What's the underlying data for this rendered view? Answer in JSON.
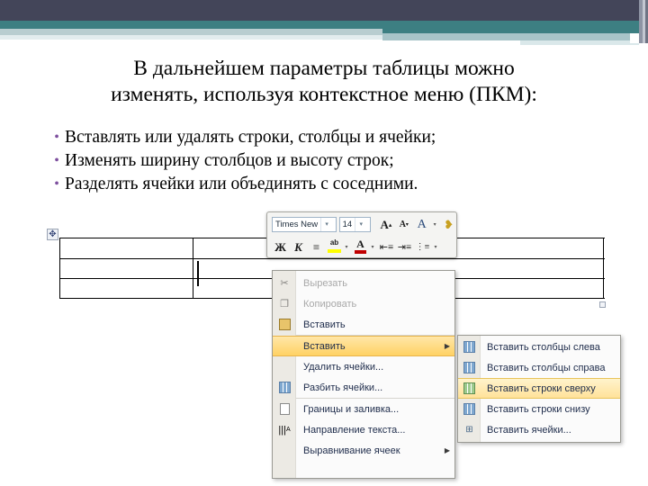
{
  "slide": {
    "title_lines": [
      "В дальнейшем параметры таблицы можно",
      "изменять, используя контекстное меню (ПКМ):"
    ],
    "bullets": [
      "Вставлять или удалять строки, столбцы и ячейки;",
      "Изменять ширину столбцов и высоту строк;",
      "Разделять ячейки или объединять с соседними."
    ],
    "bullet_marker": "•",
    "colors": {
      "header_dark": "#434559",
      "header_teal": "#3d7f82",
      "header_pale": "#b8cdd0",
      "bullet_marker": "#7d4f9e",
      "menu_highlight": "#ffd264",
      "text": "#000000"
    }
  },
  "mini_toolbar": {
    "font_name": "Times New",
    "font_size": "14",
    "dropdown_arrow": "▾",
    "buttons": [
      {
        "name": "grow-font",
        "glyph": "A"
      },
      {
        "name": "shrink-font",
        "glyph": "A"
      },
      {
        "name": "clear-formatting",
        "glyph": "A"
      },
      {
        "name": "format-painter",
        "glyph": "✔"
      },
      {
        "name": "bold",
        "glyph": "Ж"
      },
      {
        "name": "italic",
        "glyph": "K"
      },
      {
        "name": "center",
        "glyph": "≡"
      },
      {
        "name": "highlight",
        "glyph": "ab"
      },
      {
        "name": "font-color",
        "glyph": "A"
      },
      {
        "name": "decrease-indent",
        "glyph": "≼"
      },
      {
        "name": "increase-indent",
        "glyph": "≽"
      },
      {
        "name": "bullets",
        "glyph": "≔"
      }
    ]
  },
  "context_menu": {
    "items": [
      {
        "label": "Вырезать",
        "icon": "scissors-icon",
        "disabled": true,
        "submenu": false,
        "divider_after": false
      },
      {
        "label": "Копировать",
        "icon": "copy-icon",
        "disabled": true,
        "submenu": false,
        "divider_after": false
      },
      {
        "label": "Вставить",
        "icon": "paste-icon",
        "disabled": false,
        "submenu": false,
        "divider_after": true
      },
      {
        "label": "Вставить",
        "icon": "insert-icon",
        "disabled": false,
        "submenu": true,
        "divider_after": false,
        "selected": true
      },
      {
        "label": "Удалить ячейки...",
        "icon": "delete-cells-icon",
        "disabled": false,
        "submenu": false,
        "divider_after": false
      },
      {
        "label": "Разбить ячейки...",
        "icon": "split-cells-icon",
        "disabled": false,
        "submenu": false,
        "divider_after": true
      },
      {
        "label": "Границы и заливка...",
        "icon": "borders-shading-icon",
        "disabled": false,
        "submenu": false,
        "divider_after": false
      },
      {
        "label": "Направление текста...",
        "icon": "text-direction-icon",
        "disabled": false,
        "submenu": false,
        "divider_after": false
      },
      {
        "label": "Выравнивание ячеек",
        "icon": "cell-align-icon",
        "disabled": false,
        "submenu": true,
        "divider_after": false
      }
    ],
    "scissors_glyph": "✂",
    "copy_glyph": "❐",
    "text_direction_glyph": "A",
    "align_glyph": "▤",
    "submenu_arrow": "▶"
  },
  "submenu": {
    "items": [
      {
        "label": "Вставить столбцы слева",
        "icon": "insert-columns-left-icon",
        "selected": false
      },
      {
        "label": "Вставить столбцы справа",
        "icon": "insert-columns-right-icon",
        "selected": false
      },
      {
        "label": "Вставить строки сверху",
        "icon": "insert-rows-above-icon",
        "selected": true
      },
      {
        "label": "Вставить строки снизу",
        "icon": "insert-rows-below-icon",
        "selected": false
      },
      {
        "label": "Вставить ячейки...",
        "icon": "insert-cells-icon",
        "selected": false
      }
    ]
  },
  "table": {
    "move_handle_glyph": "✥",
    "rows": 3,
    "columns": 2
  }
}
